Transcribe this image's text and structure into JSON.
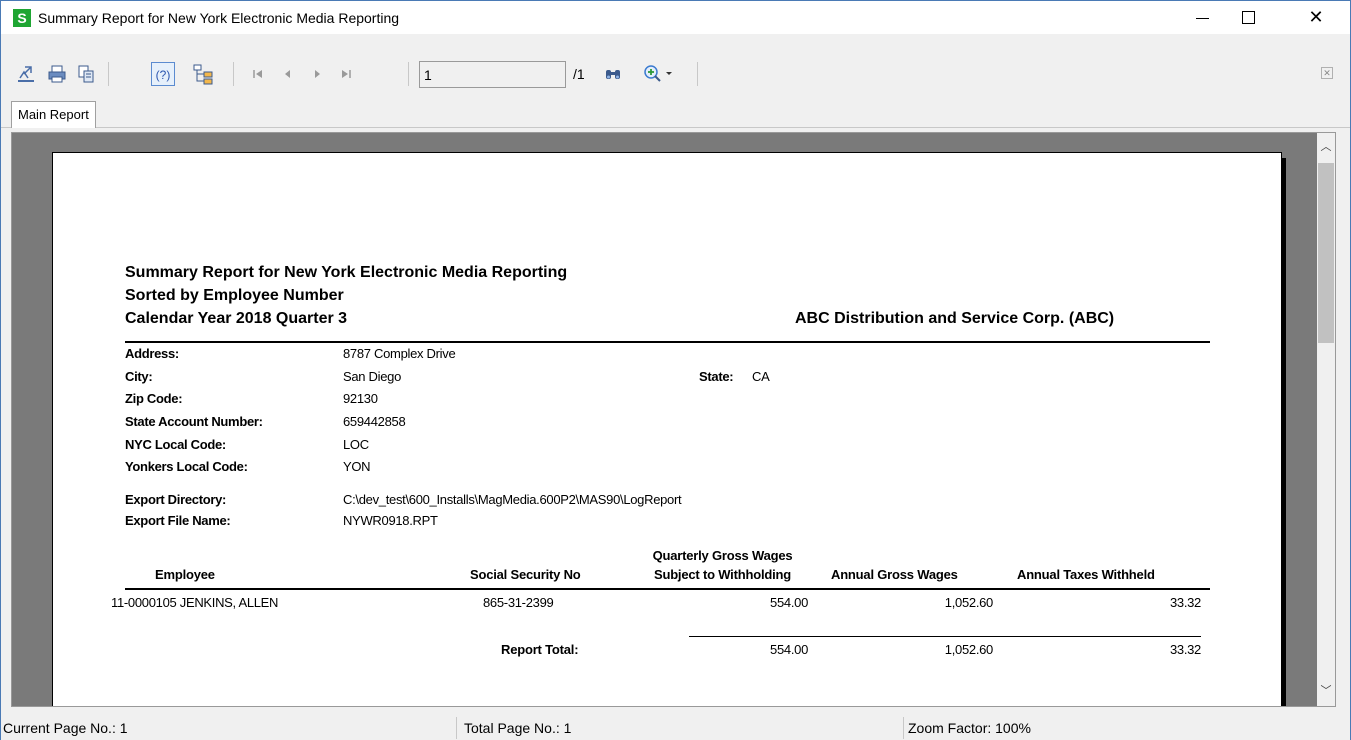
{
  "window": {
    "title": "Summary Report for New York Electronic Media Reporting",
    "app_icon_letter": "S"
  },
  "toolbar": {
    "page_value": "1",
    "page_total": "/1",
    "icons": [
      "export-icon",
      "print-icon",
      "copy-icon",
      "help-icon",
      "group-tree-icon",
      "first-page-icon",
      "prev-page-icon",
      "next-page-icon",
      "last-page-icon",
      "search-icon",
      "zoom-icon",
      "close-icon"
    ]
  },
  "tabs": [
    {
      "label": "Main Report"
    }
  ],
  "report": {
    "title_line1": "Summary Report for New York Electronic Media Reporting",
    "title_line2": "Sorted by Employee Number",
    "title_line3": "Calendar Year 2018 Quarter 3",
    "company": "ABC Distribution and Service Corp. (ABC)",
    "fields": {
      "address_label": "Address:",
      "address_value": "8787 Complex Drive",
      "city_label": "City:",
      "city_value": "San Diego",
      "state_label": "State:",
      "state_value": "CA",
      "zip_label": "Zip Code:",
      "zip_value": "92130",
      "state_acct_label": "State Account Number:",
      "state_acct_value": "659442858",
      "nyc_label": "NYC Local Code:",
      "nyc_value": "LOC",
      "yonkers_label": "Yonkers Local Code:",
      "yonkers_value": "YON",
      "export_dir_label": "Export Directory:",
      "export_dir_value": "C:\\dev_test\\600_Installs\\MagMedia.600P2\\MAS90\\LogReport",
      "export_file_label": "Export File Name:",
      "export_file_value": "NYWR0918.RPT"
    },
    "columns": {
      "employee": "Employee",
      "ssn": "Social Security No",
      "qgw_line1": "Quarterly Gross Wages",
      "qgw_line2": "Subject to Withholding",
      "agw": "Annual Gross Wages",
      "atw": "Annual Taxes Withheld"
    },
    "rows": [
      {
        "employee": "11-0000105   JENKINS, ALLEN",
        "ssn": "865-31-2399",
        "qgw": "554.00",
        "agw": "1,052.60",
        "atw": "33.32"
      }
    ],
    "total": {
      "label": "Report Total:",
      "qgw": "554.00",
      "agw": "1,052.60",
      "atw": "33.32"
    }
  },
  "status": {
    "current_page": "Current Page No.: 1",
    "total_page": "Total Page No.: 1",
    "zoom": "Zoom Factor: 100%"
  }
}
